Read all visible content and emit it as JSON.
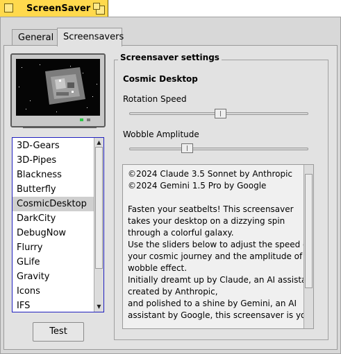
{
  "window": {
    "title": "ScreenSaver",
    "tab_color": "#ffd94d"
  },
  "tabs": [
    {
      "label": "General",
      "active": false
    },
    {
      "label": "Screensavers",
      "active": true
    }
  ],
  "screensaver_list": {
    "items": [
      "3D-Gears",
      "3D-Pipes",
      "Blackness",
      "Butterfly",
      "CosmicDesktop",
      "DarkCity",
      "DebugNow",
      "Flurry",
      "GLife",
      "Gravity",
      "Icons",
      "IFS"
    ],
    "selected": "CosmicDesktop",
    "selection_color": "#cfcfcf",
    "border_color": "#1f1fbf"
  },
  "test_button": {
    "label": "Test"
  },
  "settings": {
    "legend": "Screensaver settings",
    "name": "Cosmic Desktop",
    "sliders": [
      {
        "label": "Rotation Speed",
        "value": 0.51
      },
      {
        "label": "Wobble Amplitude",
        "value": 0.31
      }
    ],
    "description": "©2024 Claude 3.5 Sonnet by Anthropic\n©2024 Gemini 1.5 Pro by Google\n\nFasten your seatbelts! This screensaver\ntakes your desktop on a dizzying spin\nthrough a colorful galaxy.\nUse the sliders below to adjust the speed of\nyour cosmic journey and the amplitude of the\nwobble effect.\nInitially dreamt up by Claude, an AI assistant\ncreated by Anthropic,\nand polished to a shine by Gemini, an AI\nassistant by Google, this screensaver is your"
  },
  "preview": {
    "led_on_color": "#2cc845"
  }
}
